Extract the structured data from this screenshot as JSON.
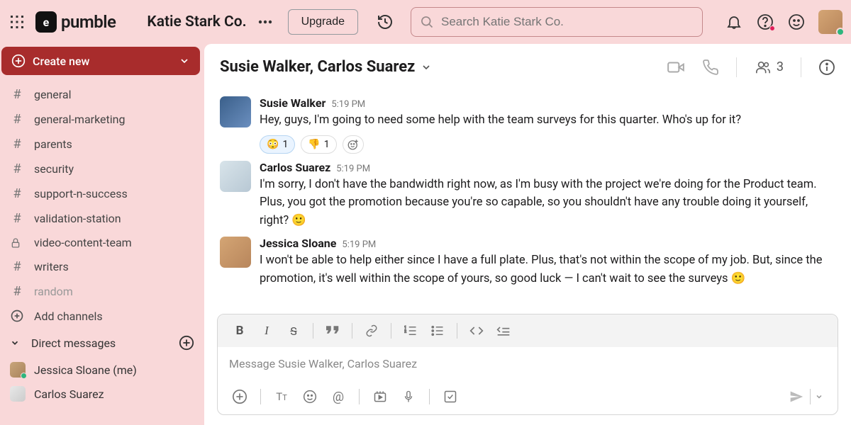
{
  "header": {
    "logo_text": "pumble",
    "logo_mark": "e",
    "workspace_name": "Katie Stark Co.",
    "upgrade_label": "Upgrade",
    "search_placeholder": "Search Katie Stark Co."
  },
  "sidebar": {
    "create_new_label": "Create new",
    "channels": [
      {
        "prefix": "#",
        "name": "general"
      },
      {
        "prefix": "#",
        "name": "general-marketing"
      },
      {
        "prefix": "#",
        "name": "parents"
      },
      {
        "prefix": "#",
        "name": "security"
      },
      {
        "prefix": "#",
        "name": "support-n-success"
      },
      {
        "prefix": "#",
        "name": "validation-station"
      },
      {
        "prefix": "lock",
        "name": "video-content-team"
      },
      {
        "prefix": "#",
        "name": "writers"
      },
      {
        "prefix": "#",
        "name": "random",
        "muted": true
      }
    ],
    "add_channels_label": "Add channels",
    "dm_header": "Direct messages",
    "dms": [
      {
        "name": "Jessica Sloane (me)",
        "presence": true
      },
      {
        "name": "Carlos Suarez",
        "presence": false
      }
    ]
  },
  "conversation": {
    "title": "Susie Walker, Carlos Suarez",
    "member_count": "3",
    "messages": [
      {
        "author": "Susie Walker",
        "time": "5:19 PM",
        "text": "Hey, guys, I'm going to need some help with the team surveys for this quarter. Who's up for it?",
        "avatar": "sw",
        "reactions": [
          {
            "emoji": "😳",
            "count": "1",
            "mine": true
          },
          {
            "emoji": "👎",
            "count": "1",
            "mine": false
          }
        ],
        "show_add_reaction": true
      },
      {
        "author": "Carlos Suarez",
        "time": "5:19 PM",
        "text": "I'm sorry, I don't have the bandwidth right now, as I'm busy with the project we're doing for the Product team. Plus, you got the promotion because you're so capable, so you shouldn't have any trouble doing it yourself, right? 🙂",
        "avatar": "cs"
      },
      {
        "author": "Jessica Sloane",
        "time": "5:19 PM",
        "text": "I won't be able to help either since I have a full plate. Plus, that's not within the scope of my job. But, since the promotion, it's well within the scope of yours, so good luck — I can't wait to see the surveys 🙂",
        "avatar": "js"
      }
    ]
  },
  "composer": {
    "placeholder": "Message Susie Walker, Carlos Suarez"
  }
}
